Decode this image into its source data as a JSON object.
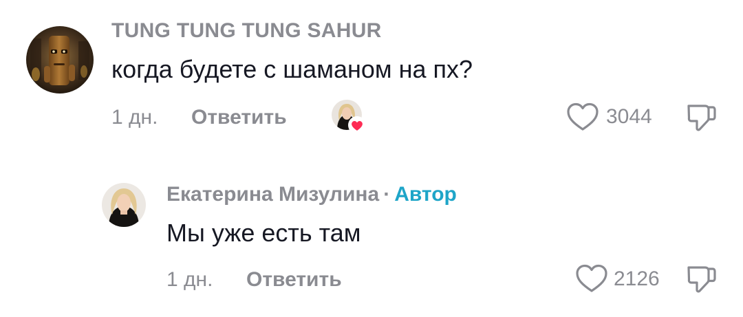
{
  "comments": [
    {
      "username": "TUNG TUNG TUNG SAHUR",
      "text": "когда будете с шаманом на пх?",
      "time": "1 дн.",
      "reply_label": "Ответить",
      "likes": "3044",
      "creator_liked": true
    },
    {
      "username": "Екатерина Мизулина",
      "separator": "·",
      "author_badge": "Автор",
      "text": "Мы уже есть там",
      "time": "1 дн.",
      "reply_label": "Ответить",
      "likes": "2126"
    }
  ],
  "colors": {
    "text": "#161823",
    "muted": "#8a8b91",
    "author_accent": "#1ea5c8",
    "heart_red": "#fe2c55"
  },
  "icons": {
    "like": "heart-outline-icon",
    "dislike": "thumbs-down-icon",
    "creator_like": "heart-filled-icon"
  }
}
